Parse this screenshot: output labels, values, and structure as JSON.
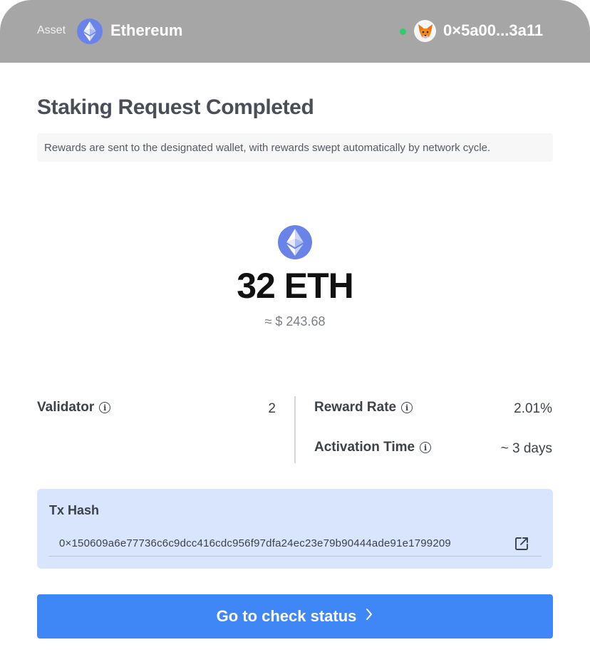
{
  "header": {
    "asset_label": "Asset",
    "asset_name": "Ethereum",
    "asset_icon": "ethereum-icon",
    "wallet_icon": "metamask-fox-icon",
    "wallet_address": "0×5a00...3a11",
    "connected_color": "#2ecc71"
  },
  "main": {
    "title": "Staking Request Completed",
    "notice": "Rewards are sent to the designated wallet, with rewards swept automatically by network cycle.",
    "amount": "32 ETH",
    "fiat": "≈ $ 243.68"
  },
  "details": {
    "validator_label": "Validator",
    "validator_value": "2",
    "reward_rate_label": "Reward Rate",
    "reward_rate_value": "2.01%",
    "activation_label": "Activation Time",
    "activation_value": "~ 3 days",
    "info_icon": "info-icon"
  },
  "tx": {
    "label": "Tx Hash",
    "hash": "0×150609a6e77736c6c9dcc416cdc956f97dfa24ec23e79b90444ade91e1799209",
    "link_icon": "external-link-icon"
  },
  "cta": {
    "label": "Go to check status",
    "icon": "chevron-right-icon",
    "color": "#3f86f7"
  }
}
